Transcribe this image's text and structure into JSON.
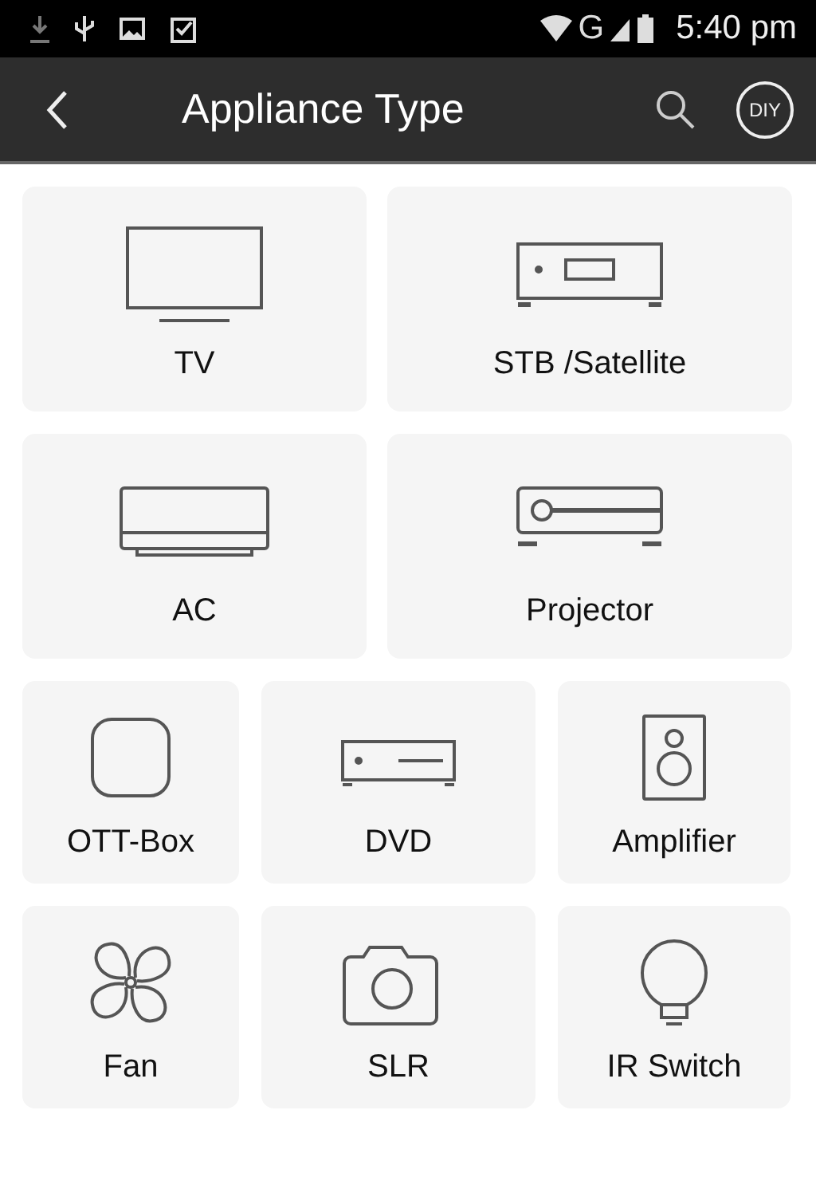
{
  "status_bar": {
    "network": "G",
    "time": "5:40 pm"
  },
  "app_bar": {
    "title": "Appliance Type",
    "diy": "DIY"
  },
  "rows": [
    [
      {
        "kind": "tv",
        "label": "TV"
      },
      {
        "kind": "stb",
        "label": "STB /Satellite"
      }
    ],
    [
      {
        "kind": "ac",
        "label": "AC"
      },
      {
        "kind": "projector",
        "label": "Projector"
      }
    ],
    [
      {
        "kind": "ott",
        "label": "OTT-Box"
      },
      {
        "kind": "dvd",
        "label": "DVD"
      },
      {
        "kind": "amplifier",
        "label": "Amplifier"
      }
    ],
    [
      {
        "kind": "fan",
        "label": "Fan"
      },
      {
        "kind": "slr",
        "label": "SLR"
      },
      {
        "kind": "irswitch",
        "label": "IR Switch"
      }
    ]
  ]
}
